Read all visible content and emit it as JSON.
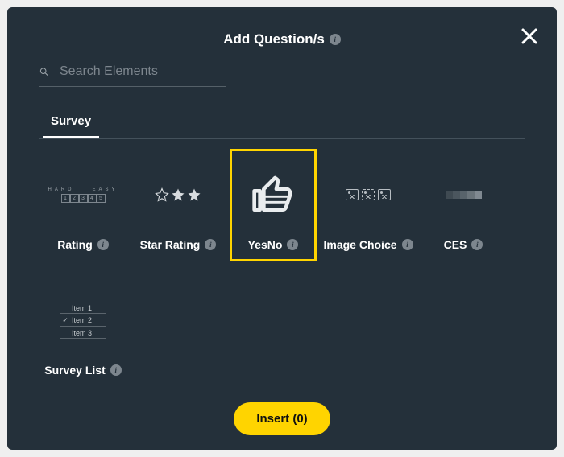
{
  "header": {
    "title": "Add Question/s"
  },
  "search": {
    "placeholder": "Search Elements"
  },
  "tabs": {
    "active": "Survey"
  },
  "tiles": {
    "rating": {
      "label": "Rating",
      "hard": "HARD",
      "easy": "EASY",
      "nums": [
        "1",
        "2",
        "3",
        "4",
        "5"
      ]
    },
    "star": {
      "label": "Star Rating"
    },
    "yesno": {
      "label": "YesNo"
    },
    "image": {
      "label": "Image Choice"
    },
    "ces": {
      "label": "CES"
    },
    "survey_list": {
      "label": "Survey List",
      "items": [
        "Item 1",
        "Item 2",
        "Item 3"
      ]
    }
  },
  "footer": {
    "insert_label": "Insert (0)"
  },
  "info_glyph": "i"
}
